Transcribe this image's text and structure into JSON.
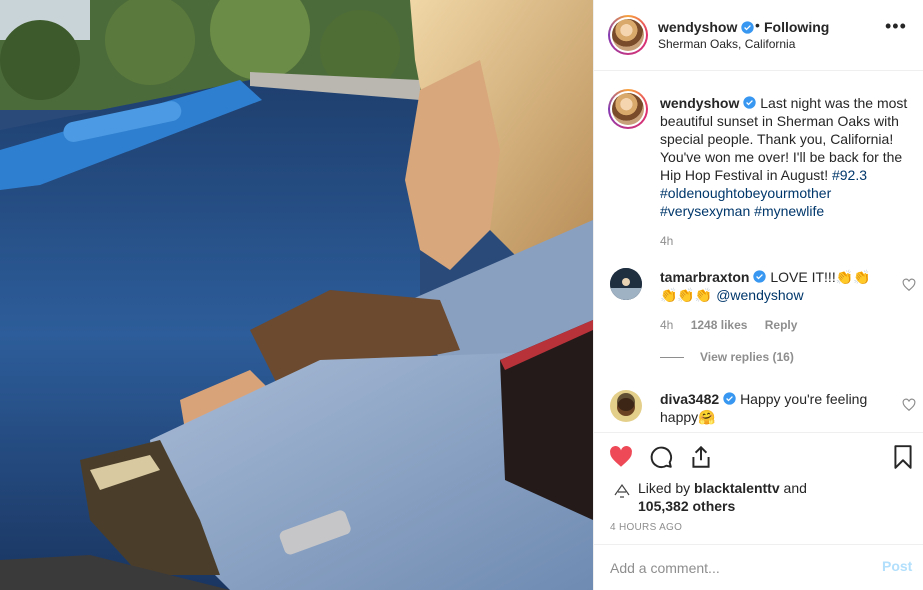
{
  "post": {
    "author": "wendyshow",
    "follow_status": "Following",
    "separator": "•",
    "location": "Sherman Oaks, California",
    "more_icon": "more-horizontal-icon"
  },
  "caption": {
    "username": "wendyshow",
    "text_main": "Last night was the most beautiful sunset in Sherman Oaks with special people. Thank you, California! You've won me over! I'll be back for the Hip Hop Festival in August!",
    "hashtags": [
      "#92.3",
      "#oldenoughtobeyourmother",
      "#verysexyman",
      "#mynewlife"
    ],
    "time": "4h"
  },
  "comments": [
    {
      "username": "tamarbraxton",
      "text": "LOVE IT!!!",
      "emoji_line2": "👏👏👏",
      "emoji_line1": "👏👏",
      "mention": "@wendyshow",
      "time": "4h",
      "likes": "1248 likes",
      "reply": "Reply"
    },
    {
      "username": "diva3482",
      "text": "Happy you're feeling happy",
      "emoji": "🤗"
    }
  ],
  "view_replies": "View replies (16)",
  "likes": {
    "prefix": "Liked by",
    "liker": "blacktalenttv",
    "middle": "and",
    "count": "105,382 others"
  },
  "timestamp": "4 HOURS AGO",
  "add_comment": {
    "placeholder": "Add a comment...",
    "post_label": "Post"
  },
  "colors": {
    "like_red": "#ed4956",
    "link_blue": "#00376b",
    "verified_blue": "#3897f0",
    "muted": "#8e8e8e"
  }
}
